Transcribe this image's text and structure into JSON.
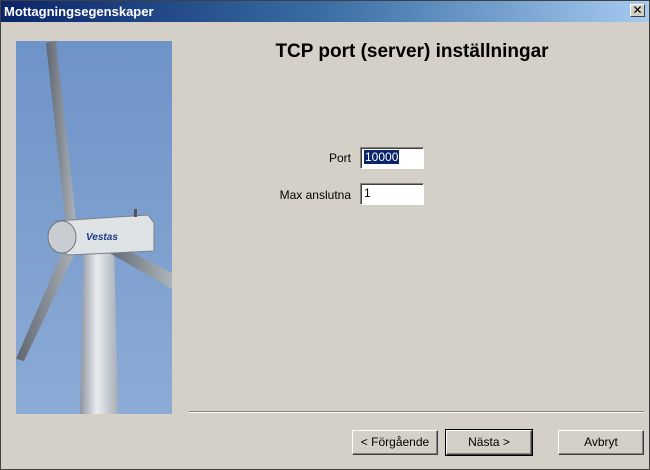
{
  "window": {
    "title": "Mottagningsegenskaper",
    "close_glyph": "✕"
  },
  "page": {
    "heading": "TCP port (server) inställningar"
  },
  "fields": {
    "port_label": "Port",
    "port_value": "10000",
    "max_label": "Max anslutna",
    "max_value": "1"
  },
  "buttons": {
    "back": "< Förgående",
    "next": "Nästa >",
    "cancel": "Avbryt"
  },
  "image": {
    "brand_text": "Vestas"
  }
}
